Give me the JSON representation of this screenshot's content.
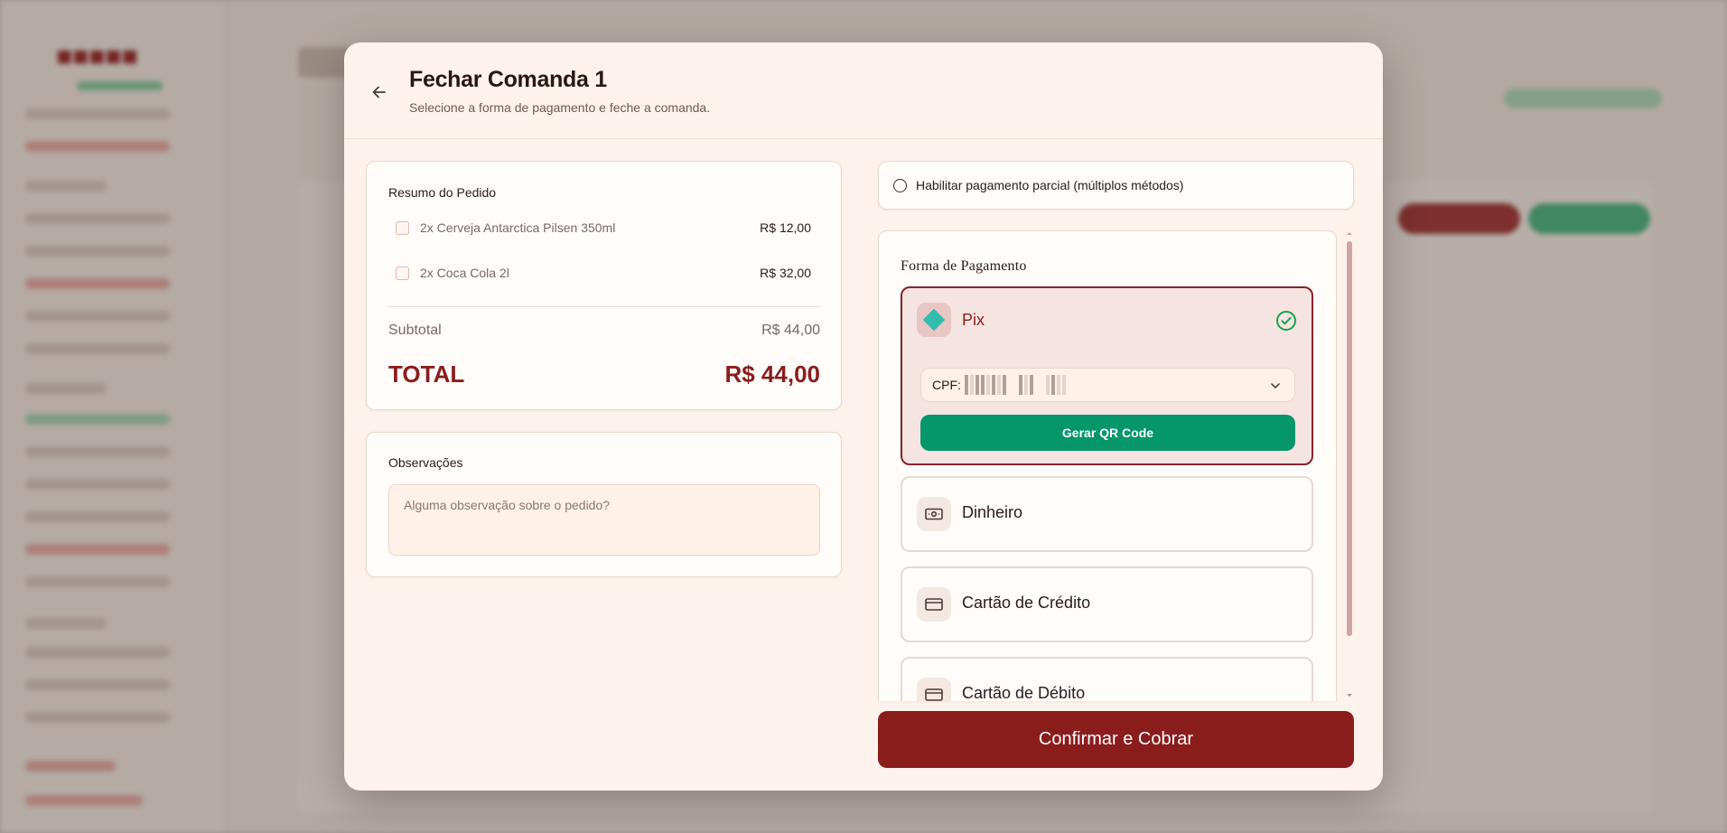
{
  "modal": {
    "title": "Fechar Comanda 1",
    "subtitle": "Selecione a forma de pagamento e feche a comanda."
  },
  "order_summary": {
    "title": "Resumo do Pedido",
    "items": [
      {
        "name": "2x Cerveja Antarctica Pilsen 350ml",
        "price": "R$ 12,00"
      },
      {
        "name": "2x Coca Cola 2l",
        "price": "R$ 32,00"
      }
    ],
    "subtotal_label": "Subtotal",
    "subtotal_value": "R$ 44,00",
    "total_label": "TOTAL",
    "total_value": "R$ 44,00"
  },
  "observations": {
    "title": "Observações",
    "placeholder": "Alguma observação sobre o pedido?"
  },
  "partial_payment": {
    "label": "Habilitar pagamento parcial (múltiplos métodos)"
  },
  "payment": {
    "title": "Forma de Pagamento",
    "methods": [
      {
        "label": "Pix",
        "icon": "pix-icon",
        "selected": true
      },
      {
        "label": "Dinheiro",
        "icon": "cash-icon",
        "selected": false
      },
      {
        "label": "Cartão de Crédito",
        "icon": "credit-card-icon",
        "selected": false
      },
      {
        "label": "Cartão de Débito",
        "icon": "debit-card-icon",
        "selected": false
      }
    ],
    "cpf_label": "CPF:",
    "qr_button": "Gerar QR Code"
  },
  "confirm_button": "Confirmar e Cobrar",
  "colors": {
    "brand": "#8b1c1c",
    "success": "#059669",
    "modal_bg": "#fef3ec"
  }
}
